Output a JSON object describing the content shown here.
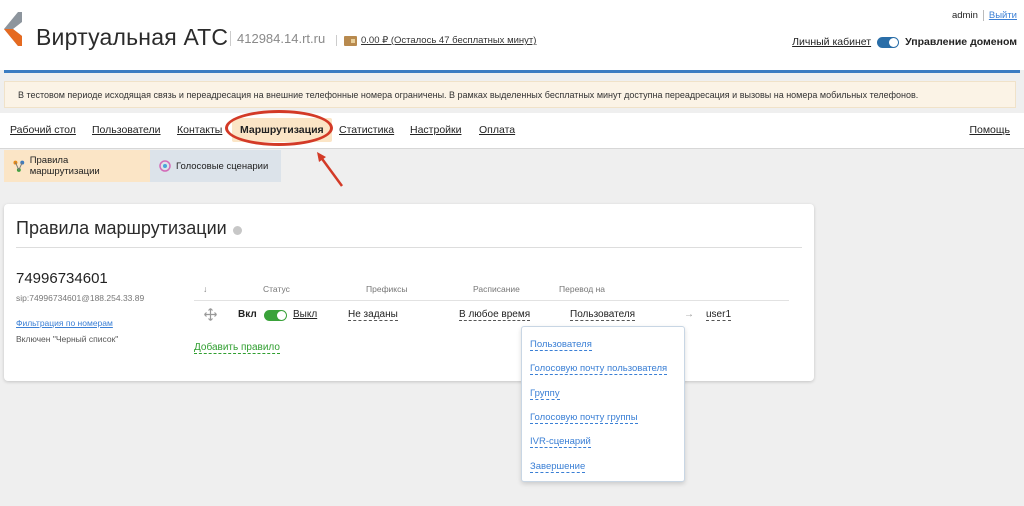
{
  "header": {
    "app_title": "Виртуальная АТС",
    "domain": "412984.14.rt.ru",
    "balance": "0.00 ₽ (Осталось 47 бесплатных минут)",
    "user": "admin",
    "logout": "Выйти",
    "cabinet_link": "Личный кабинет",
    "domain_control": "Управление доменом"
  },
  "notice": "В тестовом периоде исходящая связь и переадресация на внешние телефонные номера ограничены. В рамках выделенных бесплатных минут доступна переадресация и вызовы на номера мобильных телефонов.",
  "nav": {
    "items": [
      "Рабочий стол",
      "Пользователи",
      "Контакты",
      "Маршрутизация",
      "Статистика",
      "Настройки",
      "Оплата"
    ],
    "help": "Помощь"
  },
  "subtabs": [
    "Правила маршрутизации",
    "Голосовые сценарии"
  ],
  "panel": {
    "title": "Правила маршрутизации",
    "phone": "74996734601",
    "sip": "sip:74996734601@188.254.33.89",
    "filter": "Фильтрация по номерам",
    "blacklist": "Включен \"Черный список\"",
    "columns": {
      "sort": "↓",
      "status": "Статус",
      "prefixes": "Префиксы",
      "schedule": "Расписание",
      "forward": "Перевод на"
    },
    "rule": {
      "on": "Вкл",
      "off": "Выкл",
      "prefixes": "Не заданы",
      "schedule": "В любое время",
      "forward_type": "Пользователя",
      "arrow": "→",
      "target": "user1"
    },
    "add_rule": "Добавить правило"
  },
  "dropdown": {
    "options": [
      "Пользователя",
      "Голосовую почту пользователя",
      "Группу",
      "Голосовую почту группы",
      "IVR-сценарий",
      "Завершение"
    ]
  },
  "colors": {
    "accent_blue": "#3b7cc2",
    "active_tab": "#fbe5c6",
    "highlight_red": "#d33a27",
    "toggle_green": "#3aa23a"
  }
}
